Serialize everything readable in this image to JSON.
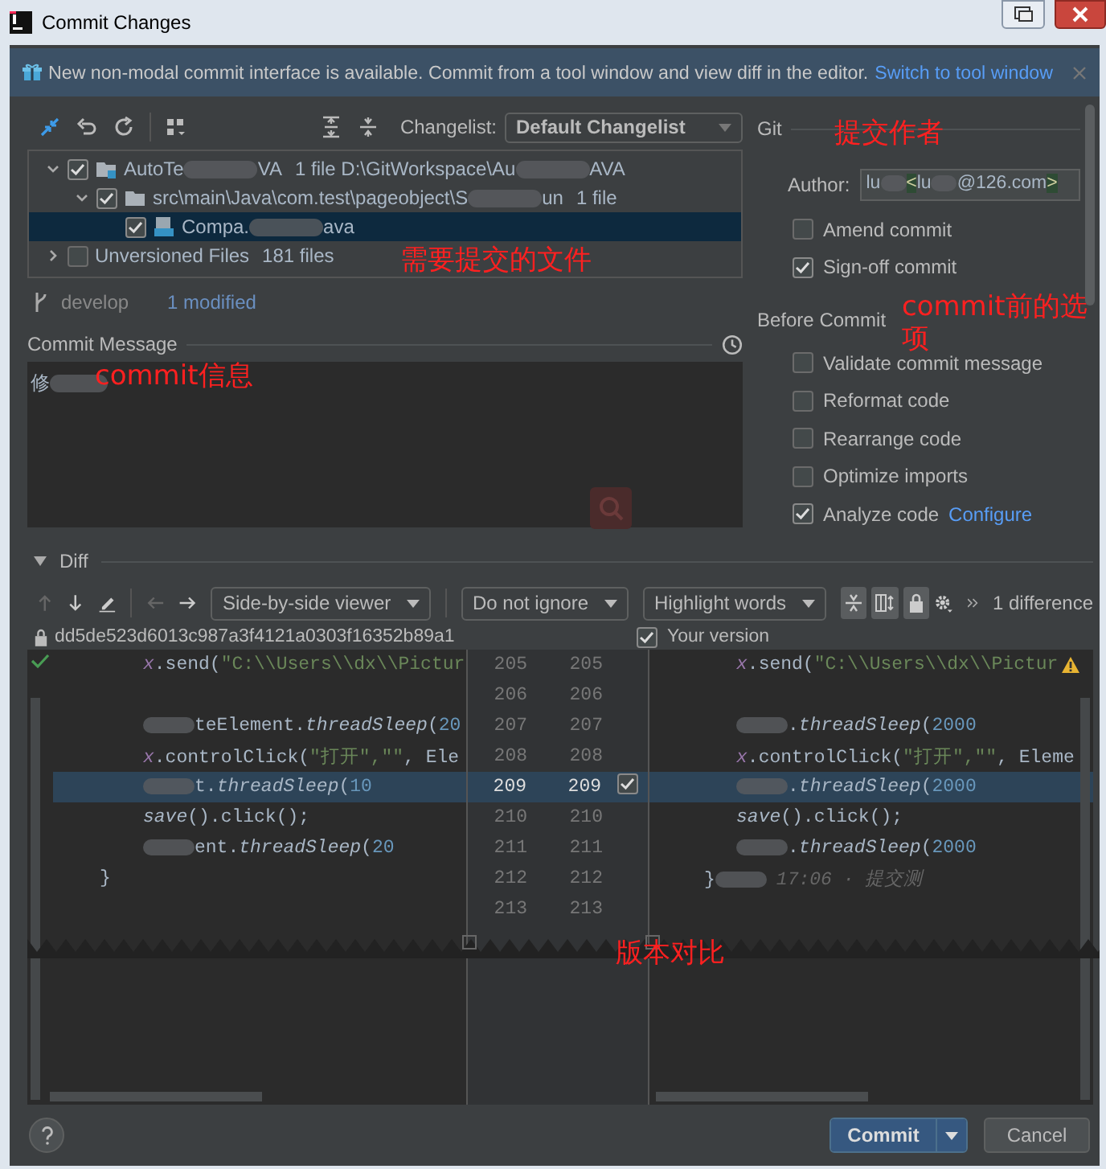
{
  "window": {
    "title": "Commit Changes"
  },
  "notification": {
    "text": "New non-modal commit interface is available. Commit from a tool window and view diff in the editor.",
    "link": "Switch to tool window"
  },
  "changes": {
    "changelist_label": "Changelist:",
    "changelist": "Default Changelist",
    "annotation": "需要提交的文件",
    "tree": [
      {
        "kind": "module",
        "checked": true,
        "expanded": true,
        "selected": false,
        "label": [
          {
            "kind": "plain",
            "text": "AutoTe"
          },
          {
            "kind": "redacted"
          },
          {
            "kind": "plain",
            "text": "VA"
          }
        ],
        "meta": [
          {
            "kind": "plain",
            "text": "1 file  D:\\GitWorkspace\\Au"
          },
          {
            "kind": "redacted"
          },
          {
            "kind": "plain",
            "text": "AVA"
          }
        ],
        "children": [
          {
            "kind": "folder",
            "checked": true,
            "expanded": true,
            "selected": false,
            "label": [
              {
                "kind": "plain",
                "text": "src\\main\\Java\\com.test\\pageobject\\S"
              },
              {
                "kind": "redacted"
              },
              {
                "kind": "plain",
                "text": "un"
              }
            ],
            "meta": [
              {
                "kind": "plain",
                "text": "1 file"
              }
            ],
            "children": [
              {
                "kind": "file",
                "checked": true,
                "selected": true,
                "label": [
                  {
                    "kind": "plain",
                    "text": "Compa."
                  },
                  {
                    "kind": "redacted"
                  },
                  {
                    "kind": "plain",
                    "text": "ava"
                  }
                ]
              }
            ]
          }
        ]
      },
      {
        "kind": "group",
        "checked": false,
        "expanded": false,
        "selected": false,
        "label": [
          {
            "kind": "plain",
            "text": "Unversioned Files"
          }
        ],
        "meta": [
          {
            "kind": "plain",
            "text": "181 files"
          }
        ]
      }
    ],
    "branch": "develop",
    "modified": "1 modified"
  },
  "commit_message": {
    "label": "Commit Message",
    "text": [
      {
        "kind": "plain",
        "text": "修"
      },
      {
        "kind": "redacted"
      }
    ],
    "annotation": "commit信息"
  },
  "git": {
    "title": "Git",
    "annotation": "提交作者",
    "author_label": "Author:",
    "author": [
      {
        "kind": "plain",
        "text": "lu"
      },
      {
        "kind": "redacted"
      },
      {
        "kind": "tag",
        "text": "<"
      },
      {
        "kind": "plain",
        "text": "lu"
      },
      {
        "kind": "redacted"
      },
      {
        "kind": "plain",
        "text": "@126.com"
      },
      {
        "kind": "tag",
        "text": ">"
      }
    ],
    "options": [
      {
        "label": "Amend commit",
        "checked": false
      },
      {
        "label": "Sign-off commit",
        "checked": true
      }
    ]
  },
  "before_commit": {
    "title": "Before Commit",
    "annotation": "commit前的选项",
    "options": [
      {
        "label": "Validate commit message",
        "checked": false
      },
      {
        "label": "Reformat code",
        "checked": false
      },
      {
        "label": "Rearrange code",
        "checked": false
      },
      {
        "label": "Optimize imports",
        "checked": false
      },
      {
        "label": "Analyze code",
        "checked": true,
        "link": "Configure"
      }
    ]
  },
  "diff": {
    "title": "Diff",
    "expanded": true,
    "viewer": "Side-by-side viewer",
    "ignore": "Do not ignore",
    "highlight": "Highlight words",
    "count": "1 difference",
    "left_title": "dd5de523d6013c987a3f4121a0303f16352b89a1",
    "right_title": "Your version",
    "right_checked": true,
    "annotation": "版本对比",
    "lines": [
      {
        "kind": "context",
        "nested": true,
        "highlighted": false,
        "warning": true,
        "left_no": "205",
        "right_no": "205",
        "left": [
          {
            "kind": "var",
            "text": "x"
          },
          {
            "kind": "plain",
            "text": ".send("
          },
          {
            "kind": "string",
            "text": "\"C:\\\\Users\\\\dx\\\\Pictur"
          }
        ],
        "right": [
          {
            "kind": "var",
            "text": "x"
          },
          {
            "kind": "plain",
            "text": ".send("
          },
          {
            "kind": "string",
            "text": "\"C:\\\\Users\\\\dx\\\\Pictur"
          }
        ]
      },
      {
        "kind": "context",
        "nested": false,
        "highlighted": false,
        "warning": false,
        "left_no": "206",
        "right_no": "206"
      },
      {
        "kind": "context",
        "nested": true,
        "highlighted": false,
        "warning": false,
        "left_no": "207",
        "right_no": "207",
        "left": [
          {
            "kind": "redacted"
          },
          {
            "kind": "plain",
            "text": "teElement."
          },
          {
            "kind": "method",
            "text": "threadSleep"
          },
          {
            "kind": "plain",
            "text": "("
          },
          {
            "kind": "num",
            "text": "20"
          }
        ],
        "right": [
          {
            "kind": "redacted"
          },
          {
            "kind": "plain",
            "text": "."
          },
          {
            "kind": "method",
            "text": "threadSleep"
          },
          {
            "kind": "plain",
            "text": "("
          },
          {
            "kind": "num",
            "text": "2000"
          }
        ]
      },
      {
        "kind": "context",
        "nested": true,
        "highlighted": false,
        "warning": false,
        "left_no": "208",
        "right_no": "208",
        "left": [
          {
            "kind": "var",
            "text": "x"
          },
          {
            "kind": "plain",
            "text": ".controlClick("
          },
          {
            "kind": "string",
            "text": "\"打开\",\"\""
          },
          {
            "kind": "plain",
            "text": ", Ele"
          }
        ],
        "right": [
          {
            "kind": "var",
            "text": "x"
          },
          {
            "kind": "plain",
            "text": ".controlClick("
          },
          {
            "kind": "string",
            "text": "\"打开\",\"\""
          },
          {
            "kind": "plain",
            "text": ", Eleme"
          }
        ]
      },
      {
        "kind": "change",
        "checked": true,
        "nested": true,
        "highlighted": true,
        "warning": false,
        "left_no": "209",
        "right_no": "209",
        "left": [
          {
            "kind": "redacted"
          },
          {
            "kind": "plain",
            "text": "t."
          },
          {
            "kind": "method",
            "text": "threadSleep"
          },
          {
            "kind": "plain",
            "text": "("
          },
          {
            "kind": "num",
            "text": "10"
          }
        ],
        "right": [
          {
            "kind": "redacted"
          },
          {
            "kind": "plain",
            "text": "."
          },
          {
            "kind": "method",
            "text": "threadSleep"
          },
          {
            "kind": "plain",
            "text": "("
          },
          {
            "kind": "num",
            "text": "2000"
          }
        ]
      },
      {
        "kind": "context",
        "nested": true,
        "highlighted": false,
        "warning": false,
        "left_no": "210",
        "right_no": "210",
        "left": [
          {
            "kind": "method",
            "text": "save"
          },
          {
            "kind": "plain",
            "text": "().click();"
          }
        ],
        "right": [
          {
            "kind": "method",
            "text": "save"
          },
          {
            "kind": "plain",
            "text": "().click();"
          }
        ]
      },
      {
        "kind": "context",
        "nested": true,
        "highlighted": false,
        "warning": false,
        "left_no": "211",
        "right_no": "211",
        "left": [
          {
            "kind": "redacted"
          },
          {
            "kind": "plain",
            "text": "ent."
          },
          {
            "kind": "method",
            "text": "threadSleep"
          },
          {
            "kind": "plain",
            "text": "("
          },
          {
            "kind": "num",
            "text": "20"
          }
        ],
        "right": [
          {
            "kind": "redacted"
          },
          {
            "kind": "plain",
            "text": "."
          },
          {
            "kind": "method",
            "text": "threadSleep"
          },
          {
            "kind": "plain",
            "text": "("
          },
          {
            "kind": "num",
            "text": "2000"
          }
        ]
      },
      {
        "kind": "context",
        "nested": false,
        "highlighted": false,
        "warning": false,
        "left_no": "212",
        "right_no": "212",
        "left": [
          {
            "kind": "plain",
            "text": "}"
          }
        ],
        "right": [
          {
            "kind": "plain",
            "text": "}"
          },
          {
            "kind": "redacted"
          },
          {
            "kind": "blame",
            "text": "17:06 · 提交测"
          }
        ]
      },
      {
        "kind": "context",
        "nested": false,
        "highlighted": false,
        "warning": false,
        "left_no": "213",
        "right_no": "213"
      }
    ]
  },
  "footer": {
    "commit": "Commit",
    "cancel": "Cancel"
  }
}
